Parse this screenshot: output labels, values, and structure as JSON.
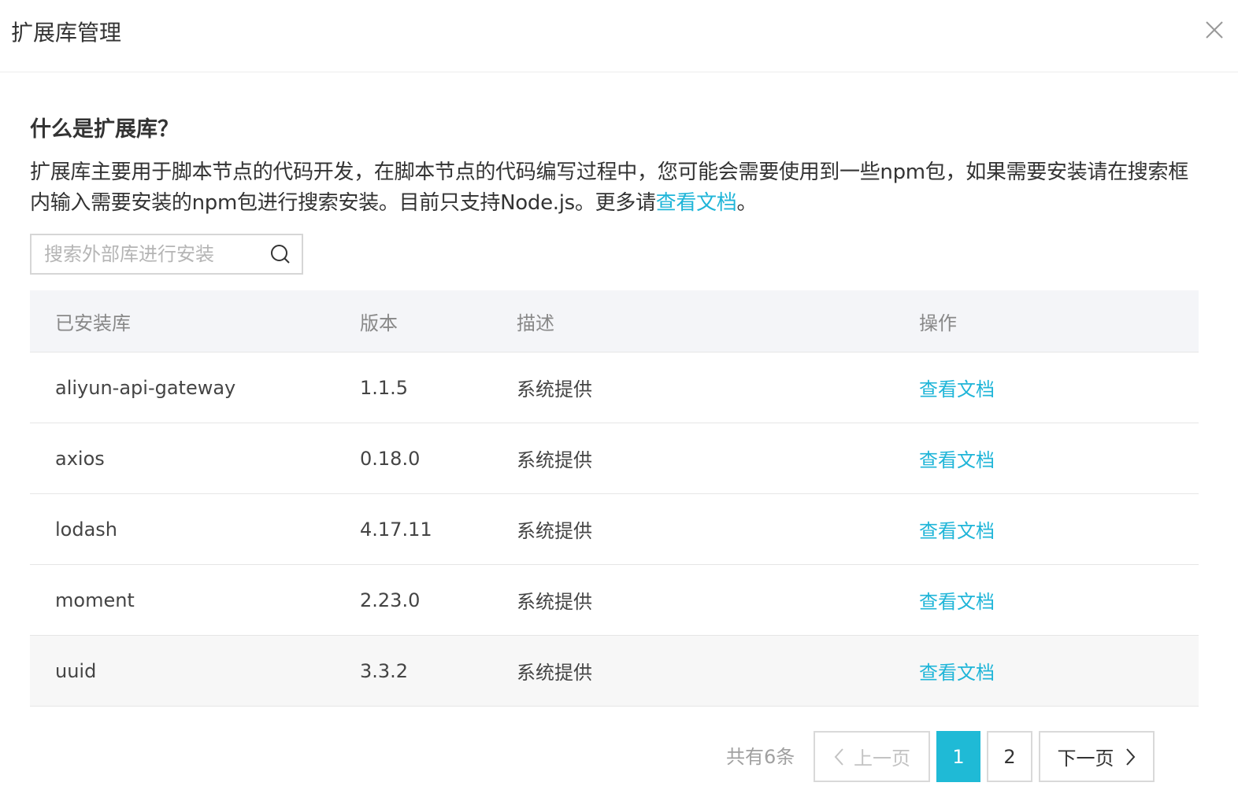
{
  "dialog": {
    "title": "扩展库管理",
    "close_icon": "close-icon"
  },
  "intro": {
    "heading": "什么是扩展库？",
    "body_text": "扩展库主要用于脚本节点的代码开发，在脚本节点的代码编写过程中，您可能会需要使用到一些npm包，如果需要安装请在搜索框内输入需要安装的npm包进行搜索安装。目前只支持Node.js。更多请",
    "link_text": "查看文档",
    "suffix": "。"
  },
  "search": {
    "placeholder": "搜索外部库进行安装",
    "value": "",
    "icon": "search-icon"
  },
  "table": {
    "headers": [
      "已安装库",
      "版本",
      "描述",
      "操作"
    ],
    "rows": [
      {
        "name": "aliyun-api-gateway",
        "version": "1.1.5",
        "description": "系统提供",
        "action": "查看文档"
      },
      {
        "name": "axios",
        "version": "0.18.0",
        "description": "系统提供",
        "action": "查看文档"
      },
      {
        "name": "lodash",
        "version": "4.17.11",
        "description": "系统提供",
        "action": "查看文档"
      },
      {
        "name": "moment",
        "version": "2.23.0",
        "description": "系统提供",
        "action": "查看文档"
      },
      {
        "name": "uuid",
        "version": "3.3.2",
        "description": "系统提供",
        "action": "查看文档"
      }
    ]
  },
  "pagination": {
    "total_text": "共有6条",
    "prev_label": "上一页",
    "next_label": "下一页",
    "pages": [
      "1",
      "2"
    ],
    "current_page": "1"
  },
  "colors": {
    "accent": "#1fb5d8",
    "header_bg": "#f4f5f8",
    "border": "#d9d9d9"
  }
}
